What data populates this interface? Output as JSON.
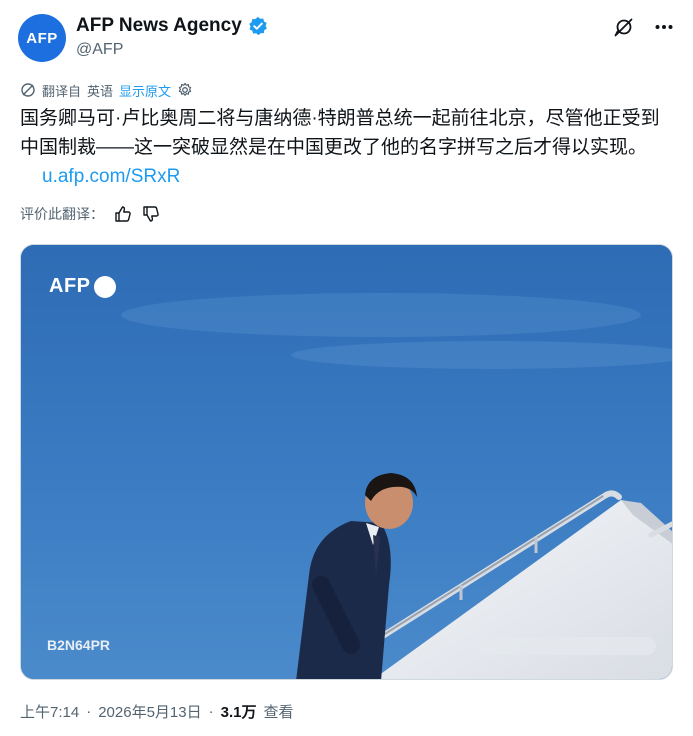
{
  "author": {
    "avatar_text": "AFP",
    "display_name": "AFP News Agency",
    "handle": "@AFP"
  },
  "translation": {
    "translated_from": "翻译自",
    "language": "英语",
    "show_original": "显示原文"
  },
  "tweet": {
    "text": "国务卿马可·卢比奥周二将与唐纳德·特朗普总统一起前往北京，尽管他正受到中国制裁——这一突破显然是在中国更改了他的名字拼写之后才得以实现。",
    "link": "u.afp.com/SRxR"
  },
  "rate_translation": {
    "label": "评价此翻译："
  },
  "media": {
    "logo_text": "AFP",
    "photo_id": "B2N64PR"
  },
  "meta": {
    "time": "上午7:14",
    "separator": "·",
    "date": "2026年5月13日",
    "views_count": "3.1万",
    "views_label": "查看"
  },
  "icons": {
    "header_action_1": "grok-icon",
    "header_action_2": "more-icon",
    "translate": "translate-icon",
    "settings": "gear-icon",
    "thumbs_up": "thumbs-up-icon",
    "thumbs_down": "thumbs-down-icon",
    "verified": "verified-badge-icon"
  },
  "colors": {
    "link": "#1d9bf0",
    "avatar": "#1d6fe0",
    "verified": "#1d9bf0",
    "secondary_text": "#536471"
  }
}
